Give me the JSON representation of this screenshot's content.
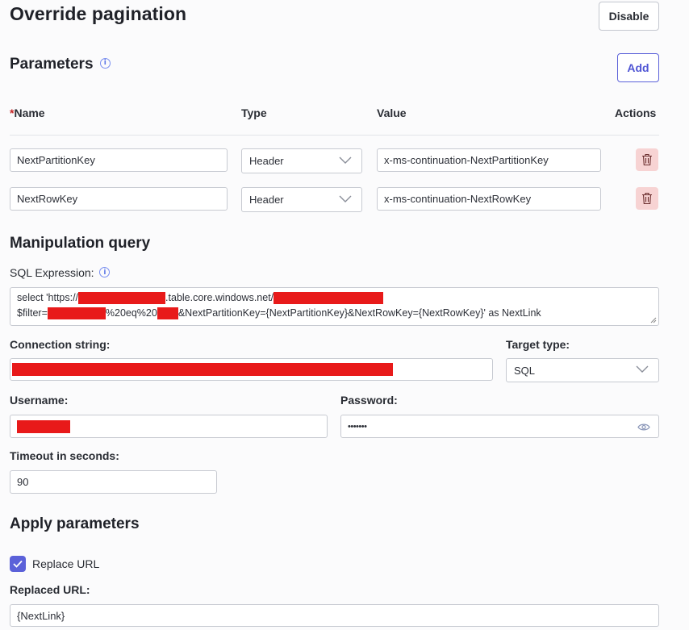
{
  "header": {
    "title": "Override pagination",
    "disable_label": "Disable"
  },
  "parameters": {
    "heading": "Parameters",
    "add_label": "Add",
    "columns": {
      "required_mark": "*",
      "name": "Name",
      "type": "Type",
      "value": "Value",
      "actions": "Actions"
    },
    "rows": [
      {
        "name": "NextPartitionKey",
        "type": "Header",
        "value": "x-ms-continuation-NextPartitionKey"
      },
      {
        "name": "NextRowKey",
        "type": "Header",
        "value": "x-ms-continuation-NextRowKey"
      }
    ]
  },
  "manipulation": {
    "heading": "Manipulation query",
    "sql_label": "SQL Expression:",
    "sql_line1_a": "select 'https://",
    "sql_line1_b": ".table.core.windows.net/",
    "sql_line2_a": "$filter=",
    "sql_line2_b": "%20eq%20",
    "sql_line2_c": "&NextPartitionKey={NextPartitionKey}&NextRowKey={NextRowKey}' as NextLink",
    "connection_label": "Connection string:",
    "target_label": "Target type:",
    "target_value": "SQL",
    "username_label": "Username:",
    "password_label": "Password:",
    "password_mask": "•••••••",
    "timeout_label": "Timeout in seconds:",
    "timeout_value": "90"
  },
  "apply": {
    "heading": "Apply parameters",
    "replace_url_label": "Replace URL",
    "replace_url_checked": true,
    "replaced_url_label": "Replaced URL:",
    "replaced_url_value": "{NextLink}"
  },
  "colors": {
    "accent": "#5b61d9",
    "danger_bg": "#f7d3d3",
    "redaction": "#e81a1a"
  },
  "icons": [
    "info-icon",
    "chevron-down-icon",
    "trash-icon",
    "eye-icon",
    "checkmark-icon"
  ]
}
